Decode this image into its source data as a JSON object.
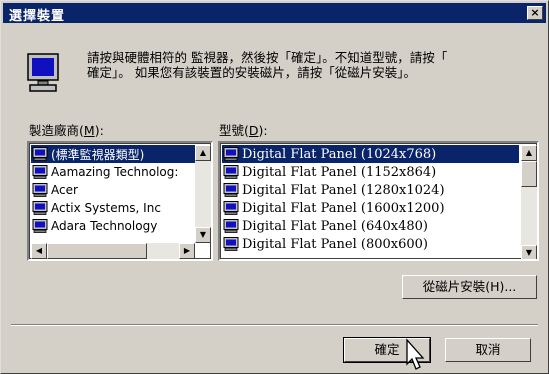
{
  "window": {
    "title": "選擇裝置",
    "close_label": "×"
  },
  "instruction": "請按與硬體相符的 監視器，然後按「確定」。不知道型號，請按「\n確定」。 如果您有該裝置的安裝磁片，請按「從磁片安裝」。",
  "manufacturer": {
    "label": "製造廠商(M):",
    "items": [
      "(標準監視器類型)",
      "Aamazing Technolog:",
      "Acer",
      "Actix Systems, Inc",
      "Adara Technology"
    ],
    "selected_index": 0
  },
  "model": {
    "label": "型號(D):",
    "items": [
      "Digital Flat Panel (1024x768)",
      "Digital Flat Panel (1152x864)",
      "Digital Flat Panel (1280x1024)",
      "Digital Flat Panel (1600x1200)",
      "Digital Flat Panel (640x480)",
      "Digital Flat Panel (800x600)"
    ],
    "selected_index": 0
  },
  "buttons": {
    "have_disk": "從磁片安裝(H)...",
    "ok": "確定",
    "cancel": "取消"
  },
  "colors": {
    "face": "#d4d0c8",
    "titlebar": "#0a246a",
    "selection": "#0a246a"
  },
  "icons": {
    "dialog": "monitor-icon",
    "row": "monitor-icon",
    "cursor": "mouse-pointer-icon"
  }
}
